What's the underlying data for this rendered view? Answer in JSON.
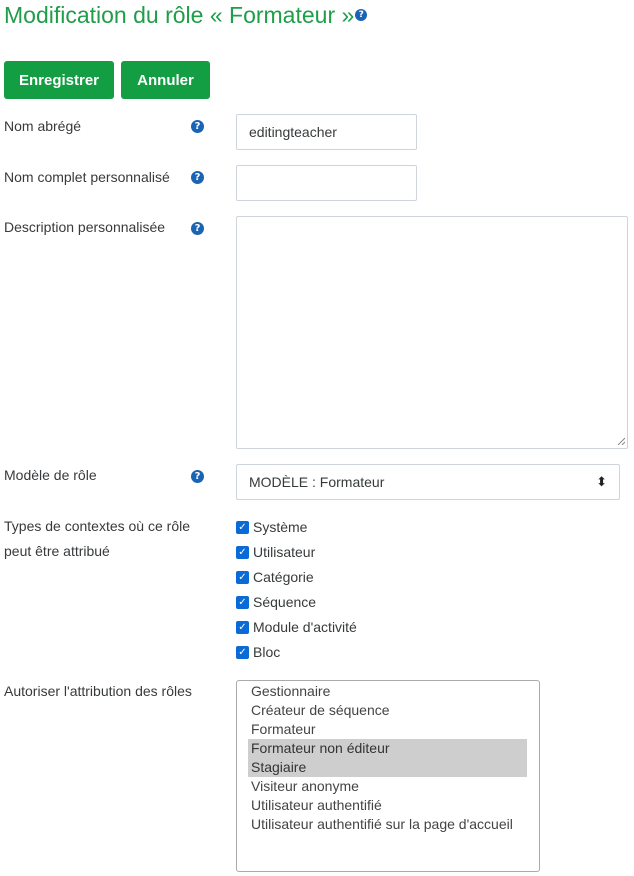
{
  "page": {
    "title": "Modification du rôle « Formateur »"
  },
  "buttons": {
    "save": "Enregistrer",
    "cancel": "Annuler"
  },
  "fields": {
    "short_name": {
      "label": "Nom abrégé",
      "value": "editingteacher"
    },
    "full_name": {
      "label": "Nom complet personnalisé",
      "value": ""
    },
    "description": {
      "label": "Description personnalisée",
      "value": ""
    },
    "archetype": {
      "label": "Modèle de rôle",
      "value": "MODÈLE : Formateur"
    },
    "contexts": {
      "label_line1": "Types de contextes où ce rôle",
      "label_line2": "peut être attribué",
      "items": [
        {
          "label": "Système",
          "checked": true
        },
        {
          "label": "Utilisateur",
          "checked": true
        },
        {
          "label": "Catégorie",
          "checked": true
        },
        {
          "label": "Séquence",
          "checked": true
        },
        {
          "label": "Module d'activité",
          "checked": true
        },
        {
          "label": "Bloc",
          "checked": true
        }
      ]
    },
    "allow_assign": {
      "label": "Autoriser l'attribution des rôles",
      "options": [
        {
          "label": "Gestionnaire",
          "selected": false
        },
        {
          "label": "Créateur de séquence",
          "selected": false
        },
        {
          "label": "Formateur",
          "selected": false
        },
        {
          "label": "Formateur non éditeur",
          "selected": true
        },
        {
          "label": "Stagiaire",
          "selected": true
        },
        {
          "label": "Visiteur anonyme",
          "selected": false
        },
        {
          "label": "Utilisateur authentifié",
          "selected": false
        },
        {
          "label": "Utilisateur authentifié sur la page d'accueil",
          "selected": false
        }
      ]
    }
  },
  "icons": {
    "help": "question-circle-icon",
    "check": "checkbox-checked-icon",
    "select_arrow": "select-updown-icon"
  },
  "colors": {
    "title": "#1f9e4a",
    "button": "#139e43",
    "help_icon": "#1b64b4",
    "checkbox": "#0a6ad6",
    "selected_option": "#cecece"
  }
}
